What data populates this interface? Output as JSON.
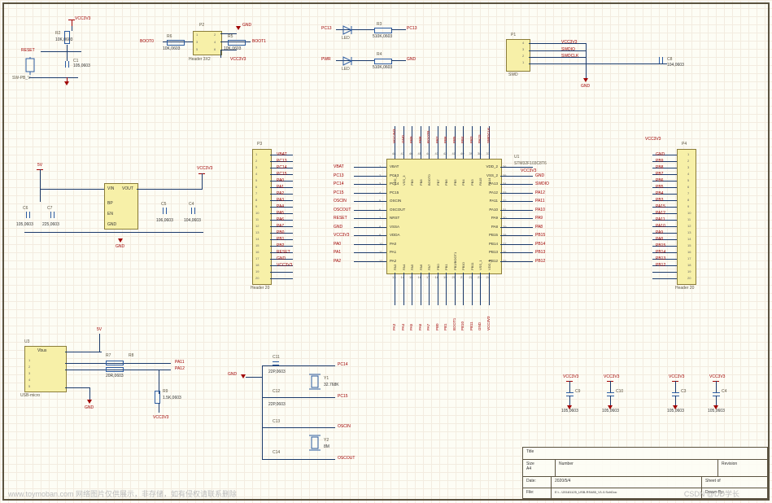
{
  "reset_block": {
    "vcc": "VCC3V3",
    "r": "R2",
    "rv": "10K,0603",
    "sw": "SW-PB_V",
    "net": "RESET",
    "c": "C1",
    "cv": "105,0603",
    "gnd": "GND"
  },
  "boot_block": {
    "p": "P2",
    "pv": "Header 3X2",
    "r1": "R6",
    "r1v": "10K,0603",
    "r2": "R5",
    "r2v": "10K,0603",
    "a": "BOOT0",
    "b": "BOOT1",
    "vcc": "VCC3V3",
    "gnd": "GND"
  },
  "led_block": {
    "led1": "PC13",
    "led1r": "R3",
    "led1rv": "510K,0603",
    "led1out": "PC13",
    "led2": "PWR",
    "led2r": "R4",
    "led2rv": "510K,0603",
    "led2out": "GND",
    "ledpart": "LED"
  },
  "swd_block": {
    "p": "P1",
    "v": "VCC3V3",
    "a": "SWDIO",
    "b": "SWDCLK",
    "gnd": "GND",
    "cv": "104,0603",
    "c": "C8"
  },
  "reg_block": {
    "vin": "VIN",
    "vout": "VOUT",
    "bp": "BP",
    "en": "EN",
    "gnd": "GND",
    "c1": "C6",
    "c1v": "105,0603",
    "c2": "C7",
    "c2v": "225,0603",
    "c3": "C5",
    "c3v": "106,0603",
    "c4": "C4",
    "c4v": "104,0603",
    "vcc5": "5V",
    "vcc3": "VCC3V3"
  },
  "p3_header": {
    "name": "P3",
    "foot": "Header 20",
    "pins": [
      "VBAT",
      "PC13",
      "PC14",
      "PC15",
      "PA0",
      "PA1",
      "PA2",
      "PA3",
      "PA4",
      "PA5",
      "PA6",
      "PA7",
      "PB0",
      "PB1",
      "PB2",
      "RESET",
      "GND",
      "VCC3V3",
      "",
      ""
    ]
  },
  "p4_header": {
    "name": "P4",
    "foot": "Header 20",
    "pins": [
      "GND",
      "PB9",
      "PB8",
      "PB7",
      "PB6",
      "PB5",
      "PB4",
      "PB3",
      "PA15",
      "PA12",
      "PA11",
      "PA10",
      "PA9",
      "PA8",
      "PB15",
      "PB14",
      "PB13",
      "PB12",
      "",
      ""
    ]
  },
  "mcu": {
    "ref": "U1",
    "part": "STM32F103C8T6",
    "left": [
      [
        "1",
        "VBAT",
        "VBAT"
      ],
      [
        "2",
        "PC13",
        "PC13"
      ],
      [
        "3",
        "PC14",
        "PC14"
      ],
      [
        "4",
        "PC15",
        "PC15"
      ],
      [
        "5",
        "OSCIN",
        "OSCIN"
      ],
      [
        "6",
        "OSCOUT",
        "OSCOUT"
      ],
      [
        "7",
        "NRST",
        "RESET"
      ],
      [
        "8",
        "VSSA",
        "GND"
      ],
      [
        "9",
        "VDDA",
        "VCC3V3"
      ],
      [
        "10",
        "PA0",
        "PA0"
      ],
      [
        "11",
        "PA1",
        "PA1"
      ],
      [
        "12",
        "PA2",
        "PA2"
      ]
    ],
    "bottom": [
      [
        "13",
        "PA3",
        "PA3"
      ],
      [
        "14",
        "PA4",
        "PA4"
      ],
      [
        "15",
        "PA5",
        "PA5"
      ],
      [
        "16",
        "PA6",
        "PA6"
      ],
      [
        "17",
        "PA7",
        "PA7"
      ],
      [
        "18",
        "PB0",
        "PB0"
      ],
      [
        "19",
        "PB1",
        "PB1"
      ],
      [
        "20",
        "PB2/BOOT1",
        "BOOT1"
      ],
      [
        "21",
        "PB10",
        "PB10"
      ],
      [
        "22",
        "PB11",
        "PB11"
      ],
      [
        "23",
        "VSS_1",
        "GND"
      ],
      [
        "24",
        "VDD_1",
        "VCC3V3"
      ]
    ],
    "right": [
      [
        "36",
        "VDD_2",
        ""
      ],
      [
        "35",
        "VSS_2",
        "GND"
      ],
      [
        "34",
        "PA13",
        "SWDIO"
      ],
      [
        "33",
        "PA12",
        "PA12"
      ],
      [
        "32",
        "PA11",
        "PA11"
      ],
      [
        "31",
        "PA10",
        "PA10"
      ],
      [
        "30",
        "PA9",
        "PA9"
      ],
      [
        "29",
        "PA8",
        "PA8"
      ],
      [
        "28",
        "PB15",
        "PB15"
      ],
      [
        "27",
        "PB14",
        "PB14"
      ],
      [
        "26",
        "PB13",
        "PB13"
      ],
      [
        "25",
        "PB12",
        "PB12"
      ]
    ],
    "top": [
      [
        "48",
        "VDD_3",
        "VCC3V3"
      ],
      [
        "47",
        "VSS_3",
        "GND"
      ],
      [
        "46",
        "PB9",
        "PB9"
      ],
      [
        "45",
        "PB8",
        "PB8"
      ],
      [
        "44",
        "BOOT0",
        "BOOT0"
      ],
      [
        "43",
        "PB7",
        "PB7"
      ],
      [
        "42",
        "PB6",
        "PB6"
      ],
      [
        "41",
        "PB5",
        "PB5"
      ],
      [
        "40",
        "PB4",
        "PB4"
      ],
      [
        "39",
        "PB3",
        "PB3"
      ],
      [
        "38",
        "PA15",
        "PA15"
      ],
      [
        "37",
        "PA14",
        "SWDCLK"
      ]
    ]
  },
  "usb_block": {
    "ref": "U3",
    "part": "USB-micro",
    "u1": "Vbus",
    "r1": "R7",
    "r2": "R8",
    "rv": "20R,0603",
    "r3": "R9",
    "r3v": "1.5K,0603",
    "pa11": "PA11",
    "pa12": "PA12",
    "gnd": "GND",
    "vcc": "VCC3V3",
    "v5": "5V"
  },
  "xtal_block": {
    "c1": "C11",
    "c1v": "22P,0603",
    "c2": "C12",
    "c2v": "22P,0603",
    "c3": "C13",
    "c3v": "",
    "c4": "C14",
    "c4v": "",
    "y": "Y1",
    "yv": "32.768K",
    "y2": "Y2",
    "y2v": "8M",
    "n1": "PC14",
    "n2": "PC15",
    "n3": "OSCIN",
    "n4": "OSCOUT",
    "gnd": "GND"
  },
  "decoupling": {
    "c": [
      [
        "C9",
        "105,0603"
      ],
      [
        "C10",
        "105,0603"
      ],
      [
        "C3",
        "105,0603"
      ],
      [
        "C4",
        "105,0603"
      ]
    ],
    "vcc": "VCC3V3",
    "gnd": "GND"
  },
  "title_block": {
    "t_title": "Title",
    "t_size": "Size",
    "t_number": "Number",
    "t_rev": "Revision",
    "t_date": "Date:",
    "t_file": "File:",
    "t_sheet": "Sheet   of",
    "t_drawn": "Drawn By:",
    "size": "A4",
    "date": "2020/5/4",
    "file": "E:\\...\\20181125_USB-RS485_V1.0.SchDoc"
  },
  "watermark": "www.toymoban.com  网络图片仅供展示，非存储，如有侵权请联系删除",
  "watermark2": "CSDN @DD学长"
}
